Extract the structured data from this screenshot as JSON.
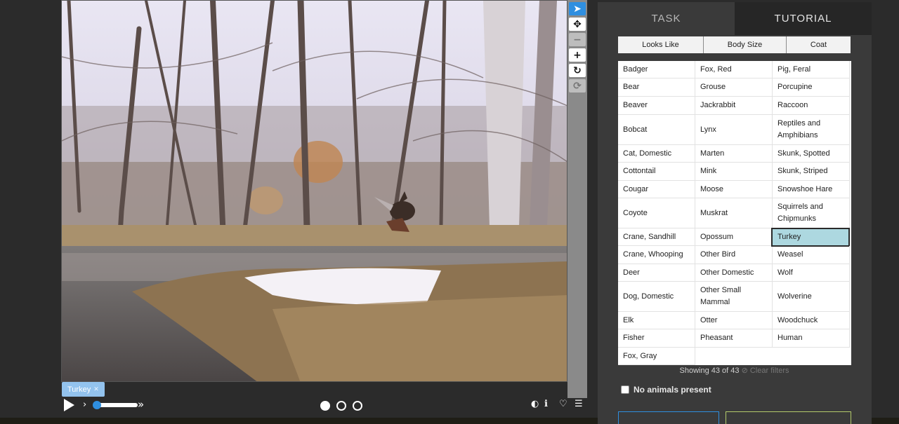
{
  "subject": {
    "image_alt": "Trail camera photo of a wild turkey flying over a marshy river with bare trees and a snow patch"
  },
  "toolbar": {
    "tools": [
      {
        "name": "annotate-tool",
        "glyph": "➤"
      },
      {
        "name": "move-tool",
        "glyph": "✥"
      },
      {
        "name": "zoom-out-tool",
        "glyph": "−"
      },
      {
        "name": "zoom-in-tool",
        "glyph": "+"
      },
      {
        "name": "rotate-tool",
        "glyph": "↻"
      },
      {
        "name": "reset-tool",
        "glyph": "⟳"
      }
    ]
  },
  "chip": {
    "label": "Turkey",
    "remove_glyph": "✕"
  },
  "player": {
    "step_back_glyph": "›",
    "fast_forward_glyph": "»",
    "speed_value": 0.0
  },
  "meta_icons": [
    {
      "name": "invert-icon",
      "glyph": "◐"
    },
    {
      "name": "info-icon",
      "glyph": "ℹ"
    },
    {
      "name": "favorite-icon",
      "glyph": "♡"
    },
    {
      "name": "collections-icon",
      "glyph": "☰"
    }
  ],
  "tabs": [
    {
      "label": "TASK",
      "active": true
    },
    {
      "label": "TUTORIAL",
      "active": false
    }
  ],
  "filters": [
    "Looks Like",
    "Body Size",
    "Coat"
  ],
  "choices": {
    "col1": [
      "Badger",
      "Bear",
      "Beaver",
      "Bobcat",
      "Cat, Domestic",
      "Cottontail",
      "Cougar",
      "Coyote",
      "Crane, Sandhill",
      "Crane, Whooping",
      "Deer",
      "Dog, Domestic",
      "Elk",
      "Fisher",
      "Fox, Gray"
    ],
    "col2": [
      "Fox, Red",
      "Grouse",
      "Jackrabbit",
      "Lynx",
      "Marten",
      "Mink",
      "Moose",
      "Muskrat",
      "Opossum",
      "Other Bird",
      "Other Domestic",
      "Other Small Mammal",
      "Otter",
      "Pheasant"
    ],
    "col3": [
      "Pig, Feral",
      "Porcupine",
      "Raccoon",
      "Reptiles and Amphibians",
      "Skunk, Spotted",
      "Skunk, Striped",
      "Snowshoe Hare",
      "Squirrels and Chipmunks",
      "Turkey",
      "Weasel",
      "Wolf",
      "Wolverine",
      "Woodchuck",
      "Human"
    ]
  },
  "status": {
    "showing": "Showing 43 of 43",
    "clear_filters": "Clear filters"
  },
  "no_animals": {
    "label": "No animals present",
    "checked": false
  },
  "colors": {
    "accent": "#2f8fe0",
    "selected_choice": "#add8e0",
    "chip": "#93c3ee"
  }
}
